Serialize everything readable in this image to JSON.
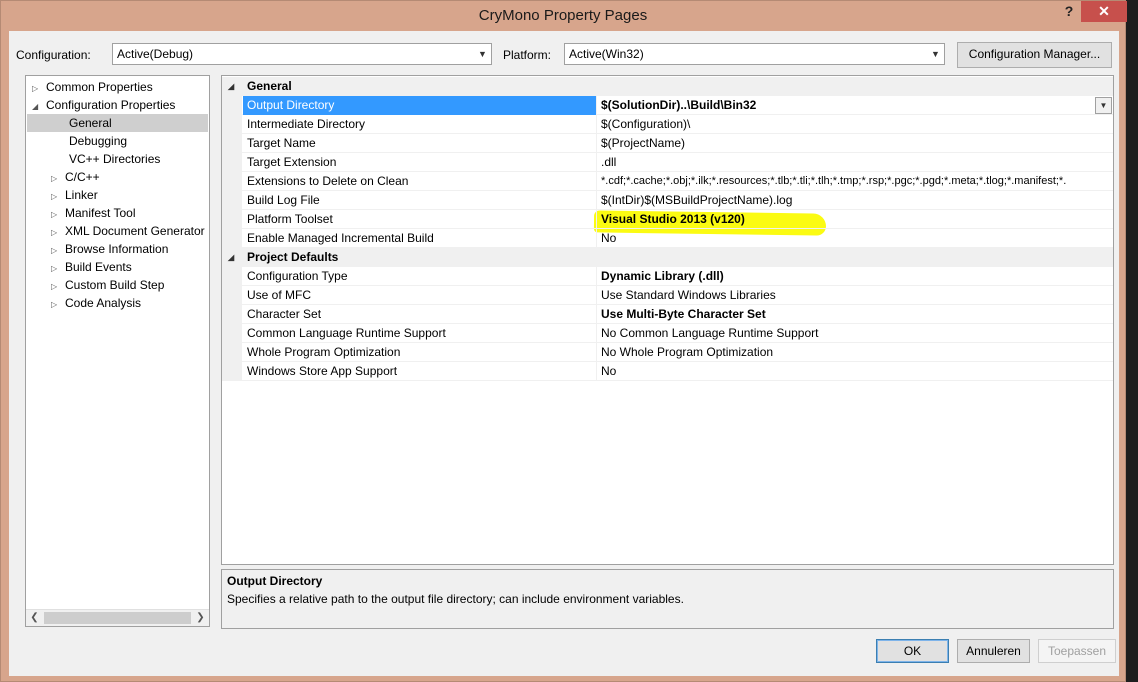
{
  "window": {
    "title": "CryMono Property Pages",
    "help_label": "?",
    "close_label": "✕"
  },
  "toolbar": {
    "configuration_label": "Configuration:",
    "configuration_value": "Active(Debug)",
    "platform_label": "Platform:",
    "platform_value": "Active(Win32)",
    "config_manager_label": "Configuration Manager..."
  },
  "tree": {
    "items": [
      {
        "label": "Common Properties",
        "level": 0,
        "expander": "collapsed"
      },
      {
        "label": "Configuration Properties",
        "level": 0,
        "expander": "expanded"
      },
      {
        "label": "General",
        "level": 1,
        "selected": true
      },
      {
        "label": "Debugging",
        "level": 1
      },
      {
        "label": "VC++ Directories",
        "level": 1
      },
      {
        "label": "C/C++",
        "level": 1,
        "expander": "collapsed"
      },
      {
        "label": "Linker",
        "level": 1,
        "expander": "collapsed"
      },
      {
        "label": "Manifest Tool",
        "level": 1,
        "expander": "collapsed"
      },
      {
        "label": "XML Document Generator",
        "level": 1,
        "expander": "collapsed"
      },
      {
        "label": "Browse Information",
        "level": 1,
        "expander": "collapsed"
      },
      {
        "label": "Build Events",
        "level": 1,
        "expander": "collapsed"
      },
      {
        "label": "Custom Build Step",
        "level": 1,
        "expander": "collapsed"
      },
      {
        "label": "Code Analysis",
        "level": 1,
        "expander": "collapsed"
      }
    ]
  },
  "grid": {
    "general": {
      "title": "General",
      "rows": [
        {
          "name": "Output Directory",
          "value": "$(SolutionDir)..\\Build\\Bin32"
        },
        {
          "name": "Intermediate Directory",
          "value": "$(Configuration)\\"
        },
        {
          "name": "Target Name",
          "value": "$(ProjectName)"
        },
        {
          "name": "Target Extension",
          "value": ".dll"
        },
        {
          "name": "Extensions to Delete on Clean",
          "value": "*.cdf;*.cache;*.obj;*.ilk;*.resources;*.tlb;*.tli;*.tlh;*.tmp;*.rsp;*.pgc;*.pgd;*.meta;*.tlog;*.manifest;*."
        },
        {
          "name": "Build Log File",
          "value": "$(IntDir)$(MSBuildProjectName).log"
        },
        {
          "name": "Platform Toolset",
          "value": "Visual Studio 2013 (v120)"
        },
        {
          "name": "Enable Managed Incremental Build",
          "value": "No"
        }
      ]
    },
    "project_defaults": {
      "title": "Project Defaults",
      "rows": [
        {
          "name": "Configuration Type",
          "value": "Dynamic Library (.dll)"
        },
        {
          "name": "Use of MFC",
          "value": "Use Standard Windows Libraries"
        },
        {
          "name": "Character Set",
          "value": "Use Multi-Byte Character Set"
        },
        {
          "name": "Common Language Runtime Support",
          "value": "No Common Language Runtime Support"
        },
        {
          "name": "Whole Program Optimization",
          "value": "No Whole Program Optimization"
        },
        {
          "name": "Windows Store App Support",
          "value": "No"
        }
      ]
    }
  },
  "description": {
    "title": "Output Directory",
    "text": "Specifies a relative path to the output file directory; can include environment variables."
  },
  "buttons": {
    "ok": "OK",
    "cancel": "Annuleren",
    "apply": "Toepassen"
  },
  "colors": {
    "title_bar": "#d7a58c",
    "close_button": "#c7504c",
    "selection": "#3399ff",
    "highlight_marker": "#fbfb12"
  }
}
